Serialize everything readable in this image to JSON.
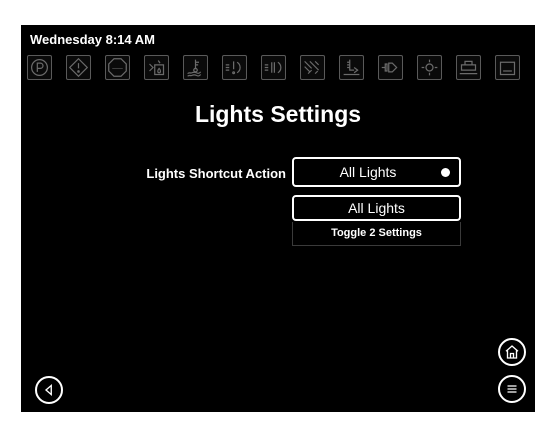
{
  "status": {
    "datetime": "Wednesday 8:14 AM"
  },
  "indicators": [
    {
      "icon": "parking-brake-icon",
      "text": "P"
    },
    {
      "icon": "warning-icon",
      "text": "!"
    },
    {
      "icon": "stop-icon",
      "text": "STOP"
    },
    {
      "icon": "water-heater-icon"
    },
    {
      "icon": "engine-temp-icon"
    },
    {
      "icon": "left-turn-signal-icon"
    },
    {
      "icon": "right-turn-signal-icon"
    },
    {
      "icon": "seatbelt-icon"
    },
    {
      "icon": "level-gauge-icon"
    },
    {
      "icon": "check-engine-icon"
    },
    {
      "icon": "light-indicator-icon"
    },
    {
      "icon": "slide-out-icon"
    },
    {
      "icon": "awning-icon"
    }
  ],
  "page": {
    "title": "Lights Settings"
  },
  "setting": {
    "label": "Lights Shortcut Action",
    "value": "All Lights"
  },
  "dropdown": {
    "options": [
      "All Lights",
      "Toggle 2 Settings"
    ]
  },
  "nav": {
    "back": "back-icon",
    "home": "home-icon",
    "menu": "menu-icon"
  }
}
